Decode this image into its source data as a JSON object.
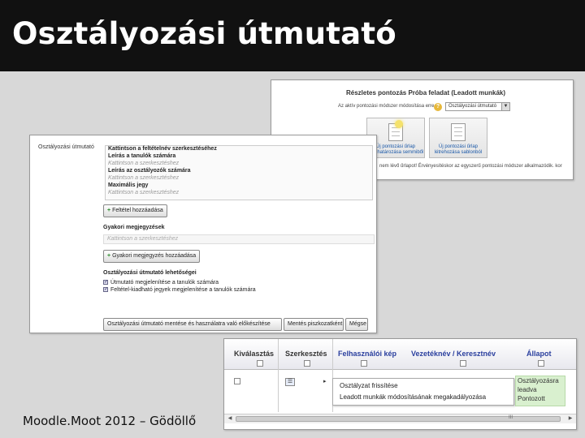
{
  "slide": {
    "title": "Osztályozási útmutató",
    "footer": "Moodle.Moot 2012 – Gödöllő"
  },
  "grading_setup": {
    "title": "Részletes pontozás Próba feladat (Leadott munkák)",
    "method_label": "Az aktív pontozási módszer módosítása erre",
    "method_value": "Osztályozási útmutató",
    "tile_new_label": "Új pontozási űrlap meghatározása semmiből",
    "tile_template_label": "Új pontozási űrlap létrehozása sablonból",
    "footer_text": "nem lévő űrlapot! Érvényesítéskor az egyszerű pontozási módszer alkalmazódik. kor"
  },
  "rubric_editor": {
    "name_label": "Osztályozási útmutató",
    "criterion_lines": [
      {
        "text": "Kattintson a feltételnév szerkesztéséhez",
        "style": "dark"
      },
      {
        "text": "Leírás a tanulók számára",
        "style": "dark"
      },
      {
        "text": "Kattintson a szerkesztéshez",
        "style": "ph"
      },
      {
        "text": "Leírás az osztályozók számára",
        "style": "dark"
      },
      {
        "text": "Kattintson a szerkesztéshez",
        "style": "ph"
      },
      {
        "text": "Maximális jegy",
        "style": "dark"
      },
      {
        "text": "Kattintson a szerkesztéshez",
        "style": "ph"
      }
    ],
    "add_criterion_button": "Feltétel hozzáadása",
    "frequent_comments_heading": "Gyakori megjegyzések",
    "comment_placeholder": "Kattintson a szerkesztéshez",
    "add_comment_button": "Gyakori megjegyzés hozzáadása",
    "options_heading": "Osztályozási útmutató lehetőségei",
    "options": [
      "Útmutató megjelenítése a tanulók számára",
      "Feltétel-kiadható jegyek megjelenítése a tanulók számára"
    ],
    "bottom_buttons": [
      "Osztályozási útmutató mentése és használatra való előkészítése",
      "Mentés piszkozatként",
      "Mégse"
    ]
  },
  "grading_table": {
    "columns": [
      "Kiválasztás",
      "Szerkesztés",
      "Felhasználói kép",
      "Vezetéknév / Keresztnév",
      "Állapot"
    ],
    "menu_items": [
      "Osztályzat frissítése",
      "Leadott munkák módosításának megakadályozása"
    ],
    "status_lines": [
      "Osztályozásra",
      "leadva",
      "Pontozott"
    ],
    "scroll_glyph": "III"
  }
}
